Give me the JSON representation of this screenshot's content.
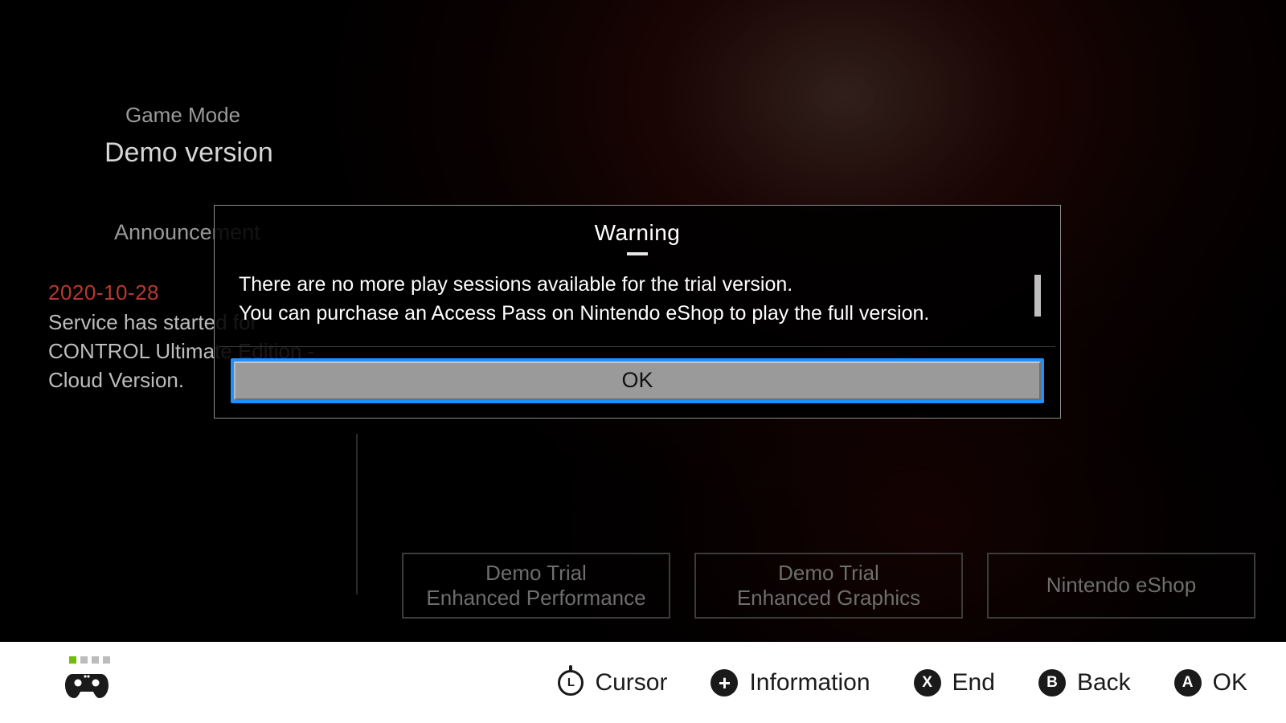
{
  "header": {
    "game_mode_label": "Game Mode",
    "game_mode_value": "Demo version",
    "announcement_label": "Announcement",
    "announcement_date": "2020-10-28",
    "announcement_body": "Service has started for CONTROL Ultimate Edition - Cloud Version."
  },
  "options": [
    {
      "line1": "Demo Trial",
      "line2": "Enhanced Performance"
    },
    {
      "line1": "Demo Trial",
      "line2": "Enhanced Graphics"
    },
    {
      "line1": "Nintendo eShop",
      "line2": ""
    }
  ],
  "dialog": {
    "title": "Warning",
    "body_line1": "There are no more play sessions available for the trial version.",
    "body_line2": "You can purchase an Access Pass on Nintendo eShop to play the full version.",
    "ok_label": "OK"
  },
  "bottombar": {
    "cursor": "Cursor",
    "information": "Information",
    "end": "End",
    "back": "Back",
    "ok": "OK",
    "btn_plus": "+",
    "btn_x": "X",
    "btn_b": "B",
    "btn_a": "A",
    "btn_l": "L"
  }
}
